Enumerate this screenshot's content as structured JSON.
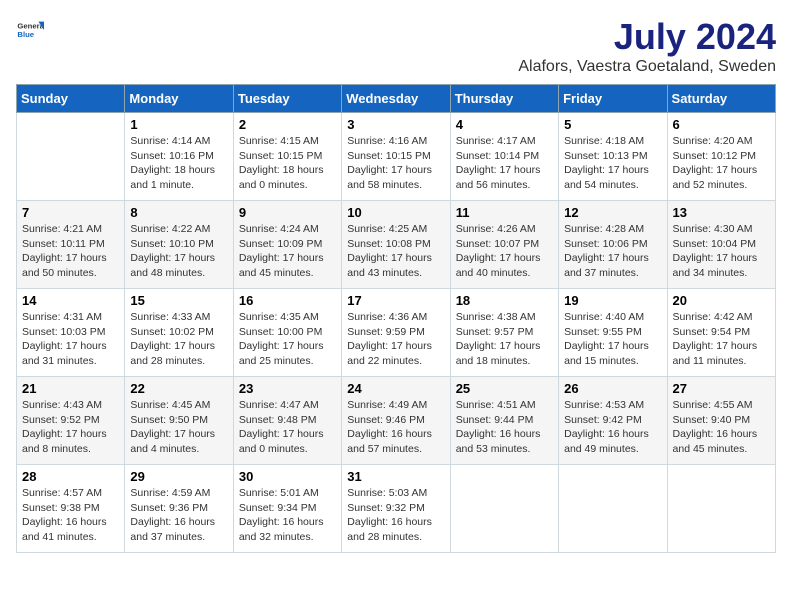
{
  "header": {
    "logo": {
      "general": "General",
      "blue": "Blue"
    },
    "title": "July 2024",
    "location": "Alafors, Vaestra Goetaland, Sweden"
  },
  "calendar": {
    "days_of_week": [
      "Sunday",
      "Monday",
      "Tuesday",
      "Wednesday",
      "Thursday",
      "Friday",
      "Saturday"
    ],
    "weeks": [
      [
        {
          "day": "",
          "info": ""
        },
        {
          "day": "1",
          "info": "Sunrise: 4:14 AM\nSunset: 10:16 PM\nDaylight: 18 hours\nand 1 minute."
        },
        {
          "day": "2",
          "info": "Sunrise: 4:15 AM\nSunset: 10:15 PM\nDaylight: 18 hours\nand 0 minutes."
        },
        {
          "day": "3",
          "info": "Sunrise: 4:16 AM\nSunset: 10:15 PM\nDaylight: 17 hours\nand 58 minutes."
        },
        {
          "day": "4",
          "info": "Sunrise: 4:17 AM\nSunset: 10:14 PM\nDaylight: 17 hours\nand 56 minutes."
        },
        {
          "day": "5",
          "info": "Sunrise: 4:18 AM\nSunset: 10:13 PM\nDaylight: 17 hours\nand 54 minutes."
        },
        {
          "day": "6",
          "info": "Sunrise: 4:20 AM\nSunset: 10:12 PM\nDaylight: 17 hours\nand 52 minutes."
        }
      ],
      [
        {
          "day": "7",
          "info": "Sunrise: 4:21 AM\nSunset: 10:11 PM\nDaylight: 17 hours\nand 50 minutes."
        },
        {
          "day": "8",
          "info": "Sunrise: 4:22 AM\nSunset: 10:10 PM\nDaylight: 17 hours\nand 48 minutes."
        },
        {
          "day": "9",
          "info": "Sunrise: 4:24 AM\nSunset: 10:09 PM\nDaylight: 17 hours\nand 45 minutes."
        },
        {
          "day": "10",
          "info": "Sunrise: 4:25 AM\nSunset: 10:08 PM\nDaylight: 17 hours\nand 43 minutes."
        },
        {
          "day": "11",
          "info": "Sunrise: 4:26 AM\nSunset: 10:07 PM\nDaylight: 17 hours\nand 40 minutes."
        },
        {
          "day": "12",
          "info": "Sunrise: 4:28 AM\nSunset: 10:06 PM\nDaylight: 17 hours\nand 37 minutes."
        },
        {
          "day": "13",
          "info": "Sunrise: 4:30 AM\nSunset: 10:04 PM\nDaylight: 17 hours\nand 34 minutes."
        }
      ],
      [
        {
          "day": "14",
          "info": "Sunrise: 4:31 AM\nSunset: 10:03 PM\nDaylight: 17 hours\nand 31 minutes."
        },
        {
          "day": "15",
          "info": "Sunrise: 4:33 AM\nSunset: 10:02 PM\nDaylight: 17 hours\nand 28 minutes."
        },
        {
          "day": "16",
          "info": "Sunrise: 4:35 AM\nSunset: 10:00 PM\nDaylight: 17 hours\nand 25 minutes."
        },
        {
          "day": "17",
          "info": "Sunrise: 4:36 AM\nSunset: 9:59 PM\nDaylight: 17 hours\nand 22 minutes."
        },
        {
          "day": "18",
          "info": "Sunrise: 4:38 AM\nSunset: 9:57 PM\nDaylight: 17 hours\nand 18 minutes."
        },
        {
          "day": "19",
          "info": "Sunrise: 4:40 AM\nSunset: 9:55 PM\nDaylight: 17 hours\nand 15 minutes."
        },
        {
          "day": "20",
          "info": "Sunrise: 4:42 AM\nSunset: 9:54 PM\nDaylight: 17 hours\nand 11 minutes."
        }
      ],
      [
        {
          "day": "21",
          "info": "Sunrise: 4:43 AM\nSunset: 9:52 PM\nDaylight: 17 hours\nand 8 minutes."
        },
        {
          "day": "22",
          "info": "Sunrise: 4:45 AM\nSunset: 9:50 PM\nDaylight: 17 hours\nand 4 minutes."
        },
        {
          "day": "23",
          "info": "Sunrise: 4:47 AM\nSunset: 9:48 PM\nDaylight: 17 hours\nand 0 minutes."
        },
        {
          "day": "24",
          "info": "Sunrise: 4:49 AM\nSunset: 9:46 PM\nDaylight: 16 hours\nand 57 minutes."
        },
        {
          "day": "25",
          "info": "Sunrise: 4:51 AM\nSunset: 9:44 PM\nDaylight: 16 hours\nand 53 minutes."
        },
        {
          "day": "26",
          "info": "Sunrise: 4:53 AM\nSunset: 9:42 PM\nDaylight: 16 hours\nand 49 minutes."
        },
        {
          "day": "27",
          "info": "Sunrise: 4:55 AM\nSunset: 9:40 PM\nDaylight: 16 hours\nand 45 minutes."
        }
      ],
      [
        {
          "day": "28",
          "info": "Sunrise: 4:57 AM\nSunset: 9:38 PM\nDaylight: 16 hours\nand 41 minutes."
        },
        {
          "day": "29",
          "info": "Sunrise: 4:59 AM\nSunset: 9:36 PM\nDaylight: 16 hours\nand 37 minutes."
        },
        {
          "day": "30",
          "info": "Sunrise: 5:01 AM\nSunset: 9:34 PM\nDaylight: 16 hours\nand 32 minutes."
        },
        {
          "day": "31",
          "info": "Sunrise: 5:03 AM\nSunset: 9:32 PM\nDaylight: 16 hours\nand 28 minutes."
        },
        {
          "day": "",
          "info": ""
        },
        {
          "day": "",
          "info": ""
        },
        {
          "day": "",
          "info": ""
        }
      ]
    ]
  }
}
